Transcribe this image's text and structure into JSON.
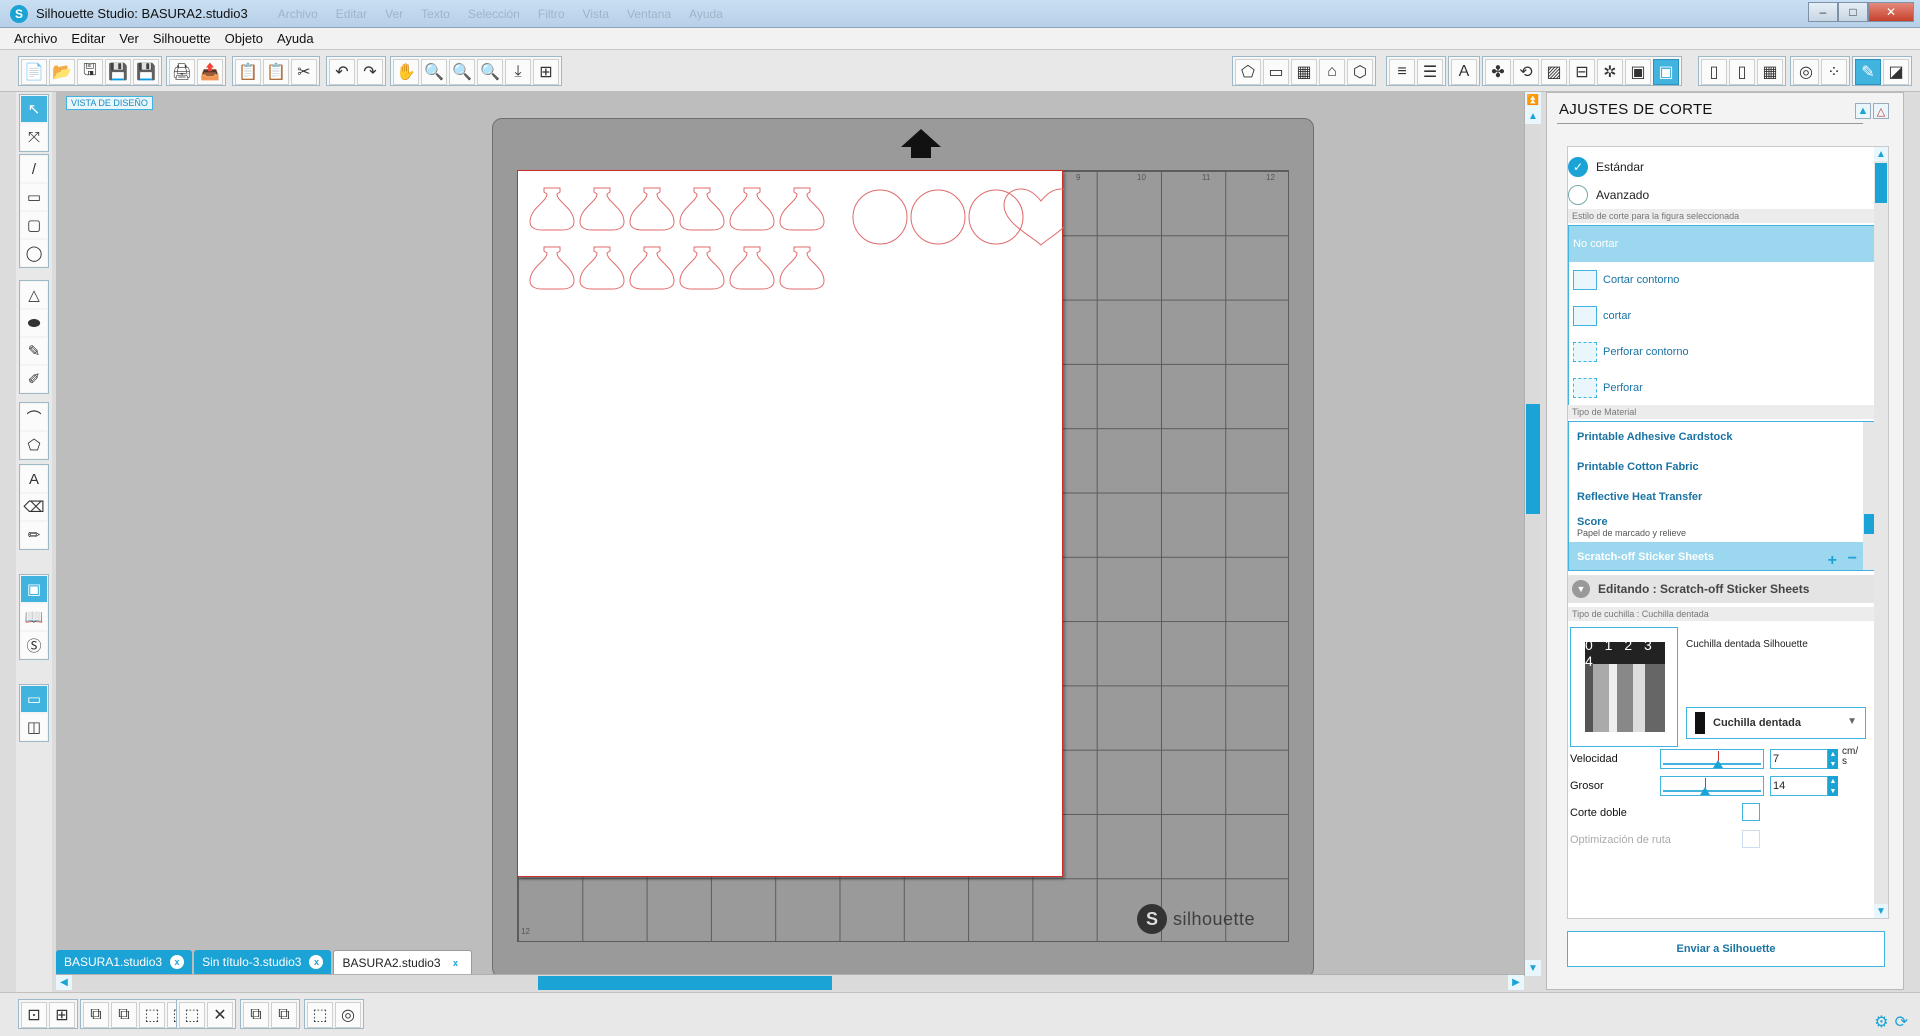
{
  "window": {
    "title": "Silhouette Studio: BASURA2.studio3",
    "logo_letter": "S",
    "ghost_menu": [
      "Archivo",
      "Editar",
      "Ver",
      "Texto",
      "Selección",
      "Filtro",
      "Vista",
      "Ventana",
      "Ayuda"
    ],
    "min": "–",
    "max": "□",
    "close": "✕"
  },
  "menu": [
    "Archivo",
    "Editar",
    "Ver",
    "Silhouette",
    "Objeto",
    "Ayuda"
  ],
  "toolbar": {
    "icons_left": [
      "📄",
      "📂",
      "🖫",
      "💾",
      "💾",
      "🖨",
      "📤",
      "📋",
      "📋",
      "✂",
      "↶",
      "↷",
      "✋",
      "🔍",
      "🔍",
      "🔍",
      "⤓",
      "⊞"
    ],
    "icons_right": [
      "⬠",
      "▭",
      "▦",
      "⌂",
      "⬡",
      "≡",
      "☰",
      "A",
      "✤",
      "⟲",
      "▨",
      "⊟",
      "✲",
      "▣",
      "▣",
      "▯",
      "▯",
      "▦",
      "◎",
      "⁘",
      "✎",
      "◪"
    ]
  },
  "left_tools": [
    "↖",
    "⤧",
    "/",
    "▭",
    "▢",
    "◯",
    "△",
    "⬬",
    "✎",
    "✐",
    "⌒",
    "⬠",
    "A",
    "⌫",
    "✏",
    "▣",
    "📖",
    "Ⓢ",
    "▭",
    "◫"
  ],
  "canvas": {
    "view_label": "VISTA DE DISEÑO",
    "ruler_top": [
      "9",
      "10",
      "11",
      "12"
    ],
    "ruler_left_bottom": "12",
    "brand_logo": "S",
    "brand_text": "silhouette"
  },
  "doc_tabs": [
    {
      "label": "BASURA1.studio3",
      "close": "x",
      "active": false
    },
    {
      "label": "Sin título-3.studio3",
      "close": "x",
      "active": false
    },
    {
      "label": "BASURA2.studio3",
      "close": "x",
      "active": true
    }
  ],
  "bottom_icons": [
    "⊡",
    "⊞",
    "⧉",
    "⧉",
    "⬚",
    "⬚",
    "⬚",
    "⬚",
    "⬚",
    "✕",
    "⧉",
    "⧉",
    "⬚",
    "◎"
  ],
  "bottom_right_icons": [
    "⚙",
    "⟳"
  ],
  "panel": {
    "title": "AJUSTES DE CORTE",
    "icon_a": "▲",
    "icon_b": "△",
    "modes": [
      {
        "label": "Estándar",
        "checked": true,
        "check": "✓"
      },
      {
        "label": "Avanzado",
        "checked": false,
        "check": ""
      }
    ],
    "cut_style_header": "Estilo de corte para la figura seleccionada",
    "cut_styles": [
      "No cortar",
      "Cortar contorno",
      "cortar",
      "Perforar contorno",
      "Perforar"
    ],
    "material_header": "Tipo de Material",
    "materials": [
      {
        "name": "Printable Adhesive Cardstock",
        "sub": ""
      },
      {
        "name": "Printable Cotton Fabric",
        "sub": ""
      },
      {
        "name": "Reflective Heat Transfer",
        "sub": ""
      },
      {
        "name": "Score",
        "sub": "Papel de marcado y relieve"
      },
      {
        "name": "Scratch-off Sticker Sheets",
        "sub": ""
      }
    ],
    "material_plus": "+",
    "material_minus": "−",
    "editing_label": "Editando : Scratch-off Sticker Sheets",
    "blade_header": "Tipo de cuchilla : Cuchilla dentada",
    "blade_numbers": "0 1 2 3 4",
    "blade_name": "Cuchilla dentada Silhouette",
    "blade_select": "Cuchilla dentada",
    "blade_caret": "▼",
    "speed_label": "Velocidad",
    "speed_value": "7",
    "speed_level": 0.55,
    "speed_unit": "cm/ s",
    "thickness_label": "Grosor",
    "thickness_value": "14",
    "thickness_level": 0.42,
    "double_cut_label": "Corte doble",
    "path_opt_label": "Optimización de ruta",
    "send_button": "Enviar a Silhouette"
  }
}
